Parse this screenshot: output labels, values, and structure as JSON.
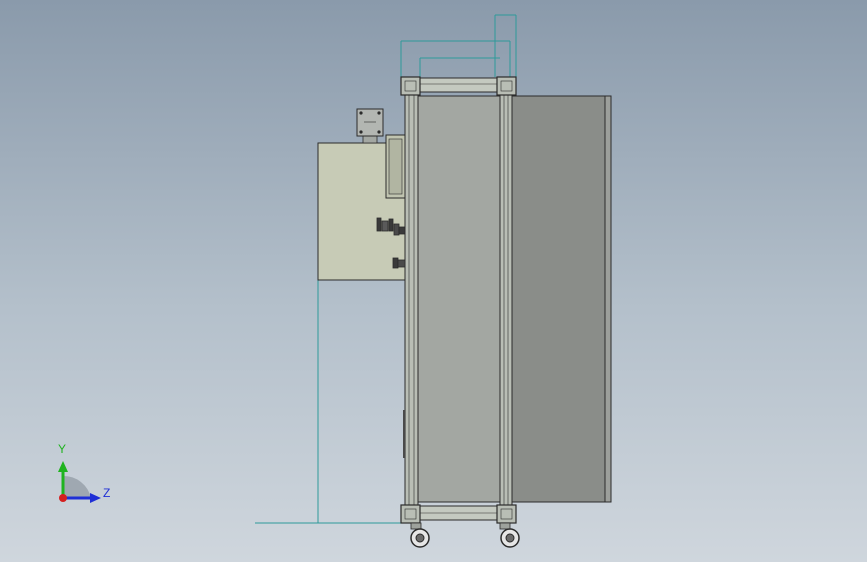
{
  "viewport": {
    "background_top": "#8a9aab",
    "background_bottom": "#cfd6dd"
  },
  "model": {
    "frame_color": "#b9beb5",
    "side_panel_color": "#a3a7a2",
    "rear_panel_color": "#8a8d89",
    "control_box_color": "#c7cbb6",
    "junction_box_color": "#b3b6b2",
    "dimension_line_color": "#2e9a9a",
    "outline_color": "#2b2b2b"
  },
  "triad": {
    "y_label": "Y",
    "z_label": "Z",
    "y_color": "#1fb31f",
    "z_color": "#1f2fd6",
    "x_color": "#d41f1f"
  }
}
